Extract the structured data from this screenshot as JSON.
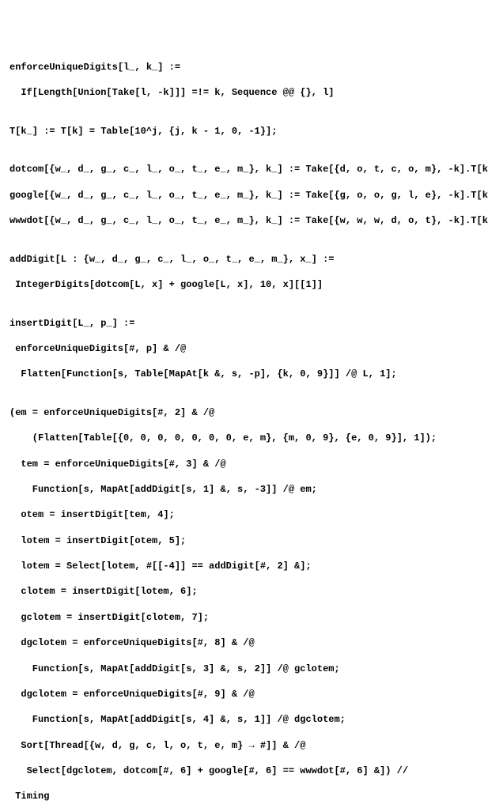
{
  "lines": {
    "l01": "enforceUniqueDigits[l_, k_] :=",
    "l02": "  If[Length[Union[Take[l, -k]]] =!= k, Sequence @@ {}, l]",
    "l03": "",
    "l04": "T[k_] := T[k] = Table[10^j, {j, k - 1, 0, -1}];",
    "l05": "",
    "l06": "dotcom[{w_, d_, g_, c_, l_, o_, t_, e_, m_}, k_] := Take[{d, o, t, c, o, m}, -k].T[k]",
    "l07": "google[{w_, d_, g_, c_, l_, o_, t_, e_, m_}, k_] := Take[{g, o, o, g, l, e}, -k].T[k]",
    "l08": "wwwdot[{w_, d_, g_, c_, l_, o_, t_, e_, m_}, k_] := Take[{w, w, w, d, o, t}, -k].T[k]",
    "l09": "",
    "l10": "addDigit[L : {w_, d_, g_, c_, l_, o_, t_, e_, m_}, x_] :=",
    "l11": " IntegerDigits[dotcom[L, x] + google[L, x], 10, x][[1]]",
    "l12": "",
    "l13": "insertDigit[L_, p_] :=",
    "l14": " enforceUniqueDigits[#, p] & /@",
    "l15": "  Flatten[Function[s, Table[MapAt[k &, s, -p], {k, 0, 9}]] /@ L, 1];",
    "l16": "",
    "l17": "(em = enforceUniqueDigits[#, 2] & /@",
    "l18": "    (Flatten[Table[{0, 0, 0, 0, 0, 0, 0, e, m}, {m, 0, 9}, {e, 0, 9}], 1]);",
    "l19": "  tem = enforceUniqueDigits[#, 3] & /@",
    "l20": "    Function[s, MapAt[addDigit[s, 1] &, s, -3]] /@ em;",
    "l21": "  otem = insertDigit[tem, 4];",
    "l22": "  lotem = insertDigit[otem, 5];",
    "l23": "  lotem = Select[lotem, #[[-4]] == addDigit[#, 2] &];",
    "l24": "  clotem = insertDigit[lotem, 6];",
    "l25": "  gclotem = insertDigit[clotem, 7];",
    "l26": "  dgclotem = enforceUniqueDigits[#, 8] & /@",
    "l27": "    Function[s, MapAt[addDigit[s, 3] &, s, 2]] /@ gclotem;",
    "l28": "  dgclotem = enforceUniqueDigits[#, 9] & /@",
    "l29": "    Function[s, MapAt[addDigit[s, 4] &, s, 1]] /@ dgclotem;",
    "l30": "  Sort[Thread[{w, d, g, c, l, o, t, e, m} → #]] & /@",
    "l31": "   Select[dgclotem, dotcom[#, 6] + google[#, 6] == wwwdot[#, 6] &]) //",
    "l32": " Timing"
  }
}
